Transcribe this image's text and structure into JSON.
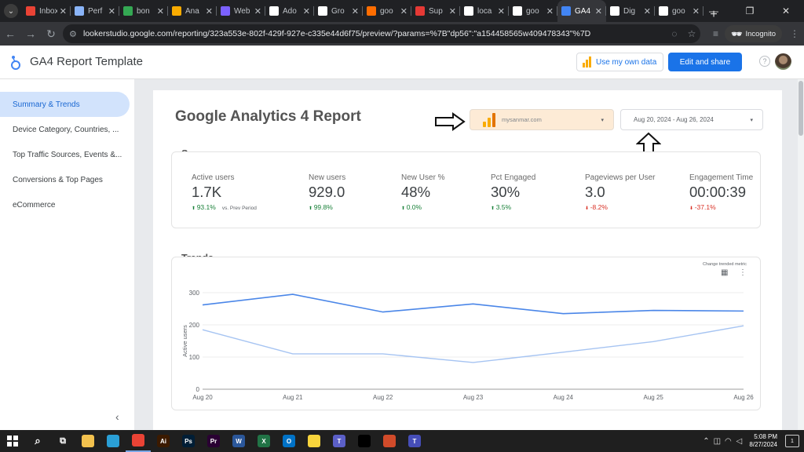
{
  "browser": {
    "tabs": [
      {
        "label": "Inbox",
        "favicon_color": "#ea4335"
      },
      {
        "label": "Perf",
        "favicon_color": "#8ab4f8"
      },
      {
        "label": "bon",
        "favicon_color": "#34a853"
      },
      {
        "label": "Ana",
        "favicon_color": "#f9ab00"
      },
      {
        "label": "Web",
        "favicon_color": "#7b61ff"
      },
      {
        "label": "Ado",
        "favicon_color": "#ffffff"
      },
      {
        "label": "Gro",
        "favicon_color": "#ffffff"
      },
      {
        "label": "goo",
        "favicon_color": "#ff6d00"
      },
      {
        "label": "Sup",
        "favicon_color": "#e53935"
      },
      {
        "label": "loca",
        "favicon_color": "#ffffff"
      },
      {
        "label": "goo",
        "favicon_color": "#ffffff"
      },
      {
        "label": "GA4",
        "favicon_color": "#4285f4",
        "active": true
      },
      {
        "label": "Dig",
        "favicon_color": "#ffffff"
      },
      {
        "label": "goo",
        "favicon_color": "#ffffff"
      }
    ],
    "new_tab_label": "+",
    "url": "lookerstudio.google.com/reporting/323a553e-802f-429f-927e-c335e44d6f75/preview/?params=%7B\"dp56\":\"a154458565w409478343\"%7D",
    "incognito_label": "Incognito"
  },
  "app": {
    "title": "GA4 Report Template",
    "use_own_data_label": "Use my own data",
    "edit_share_label": "Edit and share",
    "help_label": "?"
  },
  "sidebar": {
    "items": [
      {
        "label": "Summary & Trends",
        "active": true
      },
      {
        "label": "Device Category, Countries, ..."
      },
      {
        "label": "Top Traffic Sources, Events &..."
      },
      {
        "label": "Conversions & Top Pages"
      },
      {
        "label": "eCommerce"
      }
    ]
  },
  "report": {
    "title": "Google Analytics 4 Report",
    "data_source": "mysanmar.com",
    "date_range": "Aug 20, 2024 - Aug 26, 2024",
    "summary_title": "Summary",
    "trends_title": "Trends",
    "change_metric_hint": "Change trended metric",
    "comparison_label": "vs. Prev Period",
    "kpis": [
      {
        "label": "Active users",
        "value": "1.7K",
        "delta": "93.1%",
        "direction": "up"
      },
      {
        "label": "New users",
        "value": "929.0",
        "delta": "99.8%",
        "direction": "up"
      },
      {
        "label": "New User %",
        "value": "48%",
        "delta": "0.0%",
        "direction": "up"
      },
      {
        "label": "Pct Engaged",
        "value": "30%",
        "delta": "3.5%",
        "direction": "up"
      },
      {
        "label": "Pageviews per User",
        "value": "3.0",
        "delta": "-8.2%",
        "direction": "down"
      },
      {
        "label": "Engagement Time",
        "value": "00:00:39",
        "delta": "-37.1%",
        "direction": "down"
      }
    ]
  },
  "chart_data": {
    "type": "line",
    "categories": [
      "Aug 20",
      "Aug 21",
      "Aug 22",
      "Aug 23",
      "Aug 24",
      "Aug 25",
      "Aug 26"
    ],
    "ylabel": "Active users",
    "ylim": [
      0,
      300
    ],
    "yticks": [
      0,
      100,
      200,
      300
    ],
    "series": [
      {
        "values": [
          262,
          295,
          240,
          265,
          235,
          245,
          243
        ],
        "color": "#4a86e8"
      },
      {
        "values": [
          185,
          110,
          110,
          83,
          115,
          148,
          197
        ],
        "color": "#a6c4f2"
      }
    ],
    "grid": true,
    "legend": "none"
  },
  "taskbar": {
    "apps": [
      {
        "name": "file-explorer",
        "glyph": "",
        "color": "#f2c14e"
      },
      {
        "name": "edge",
        "glyph": "",
        "color": "#2a9fd6"
      },
      {
        "name": "chrome",
        "glyph": "",
        "color": "#ea4335",
        "running": true
      },
      {
        "name": "illustrator",
        "glyph": "Ai",
        "color": "#3b1a00"
      },
      {
        "name": "photoshop",
        "glyph": "Ps",
        "color": "#001e36"
      },
      {
        "name": "premiere",
        "glyph": "Pr",
        "color": "#2a0033"
      },
      {
        "name": "word",
        "glyph": "W",
        "color": "#2b579a"
      },
      {
        "name": "excel",
        "glyph": "X",
        "color": "#217346"
      },
      {
        "name": "outlook",
        "glyph": "O",
        "color": "#0072c6"
      },
      {
        "name": "sticky-notes",
        "glyph": "",
        "color": "#f7d43c"
      },
      {
        "name": "teams",
        "glyph": "T",
        "color": "#5b5fc7"
      },
      {
        "name": "capcut",
        "glyph": "",
        "color": "#000000"
      },
      {
        "name": "photo-app",
        "glyph": "",
        "color": "#d14b2a"
      },
      {
        "name": "teams-2",
        "glyph": "T",
        "color": "#464eb8"
      }
    ],
    "time": "5:08 PM",
    "date": "8/27/2024",
    "notifications": "1"
  }
}
